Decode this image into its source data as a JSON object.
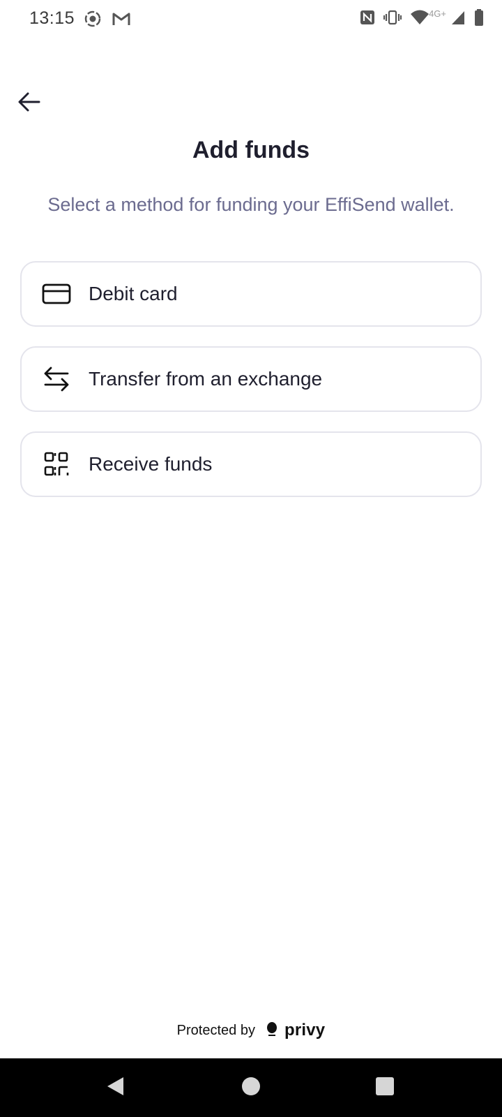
{
  "status_bar": {
    "time": "13:15",
    "network_label": "4G+",
    "left_icons": [
      "record-icon",
      "gmail-icon"
    ],
    "right_icons": [
      "nfc-icon",
      "vibrate-icon",
      "wifi-icon",
      "signal-icon",
      "battery-icon"
    ]
  },
  "header": {
    "back_icon": "arrow-left-icon",
    "title": "Add funds",
    "subtitle": "Select a method for funding your EffiSend wallet."
  },
  "options": [
    {
      "label": "Debit card",
      "icon": "credit-card-icon"
    },
    {
      "label": "Transfer from an exchange",
      "icon": "transfer-arrows-icon"
    },
    {
      "label": "Receive funds",
      "icon": "qr-code-icon"
    }
  ],
  "footer": {
    "protected_by": "Protected by",
    "brand": "privy"
  },
  "nav_bar": {
    "buttons": [
      "back-triangle-icon",
      "home-circle-icon",
      "recents-square-icon"
    ]
  },
  "colors": {
    "title": "#1f1f2e",
    "subtitle": "#6b6b8f",
    "card_border": "#e4e4ec",
    "nav_background": "#000000"
  }
}
